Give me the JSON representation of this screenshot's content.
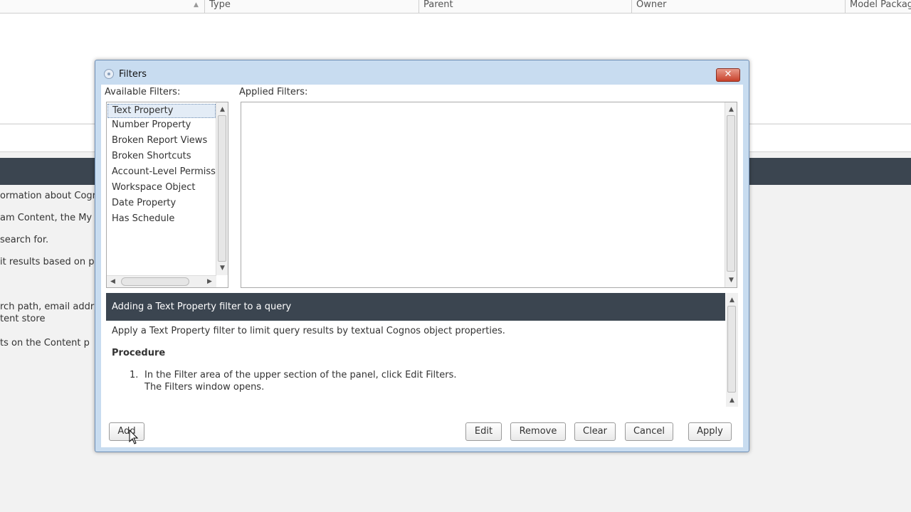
{
  "background": {
    "columns": [
      "Type",
      "Parent",
      "Owner",
      "Model Packag"
    ],
    "text_lines": [
      "ormation about Cogr",
      "am Content, the My",
      " search for.",
      "it results based on p",
      "rch path, email addr",
      "tent store",
      "ts on the Content p"
    ]
  },
  "dialog": {
    "title": "Filters",
    "close_label": "✕",
    "available_label": "Available Filters:",
    "applied_label": "Applied Filters:",
    "available_filters": [
      "Text Property",
      "Number Property",
      "Broken Report Views",
      "Broken Shortcuts",
      "Account-Level Permissio",
      "Workspace Object",
      "Date Property",
      "Has Schedule"
    ],
    "help": {
      "heading": "Adding a Text Property filter to a query",
      "intro": "Apply a Text Property filter to limit query results by textual Cognos object properties.",
      "procedure_label": "Procedure",
      "step1_num": "1.",
      "step1_line1": "In the Filter area of the upper section of the panel, click Edit Filters.",
      "step1_line2": "The Filters window opens."
    },
    "buttons": {
      "add": "Add",
      "edit": "Edit",
      "remove": "Remove",
      "clear": "Clear",
      "cancel": "Cancel",
      "apply": "Apply"
    }
  },
  "colors": {
    "dialog_frame": "#c8dcf0",
    "dark_bar": "#3b4550",
    "close_red": "#c7412b"
  }
}
